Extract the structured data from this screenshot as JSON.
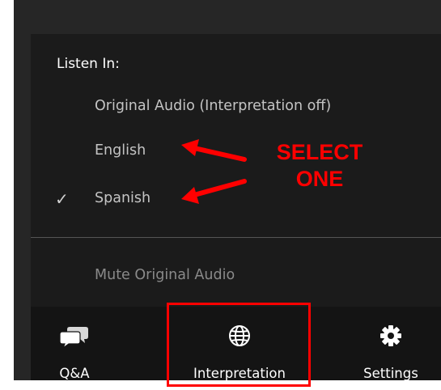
{
  "menu": {
    "heading": "Listen In:",
    "items": [
      {
        "label": "Original Audio (Interpretation off)",
        "checked": false
      },
      {
        "label": "English",
        "checked": false
      },
      {
        "label": "Spanish",
        "checked": true,
        "check_glyph": "✓"
      }
    ],
    "mute_label": "Mute Original Audio"
  },
  "toolbar": {
    "items": [
      {
        "label": "Q&A",
        "icon": "chat-bubbles-icon"
      },
      {
        "label": "Interpretation",
        "icon": "globe-icon"
      },
      {
        "label": "Settings",
        "icon": "gear-icon"
      }
    ]
  },
  "annotation": {
    "line1": "SELECT",
    "line2": "ONE",
    "color": "#ff0000"
  },
  "colors": {
    "panel": "#262626",
    "menu_bg": "#1b1b1b",
    "toolbar_bg": "#141414",
    "highlight": "#ff0000"
  }
}
